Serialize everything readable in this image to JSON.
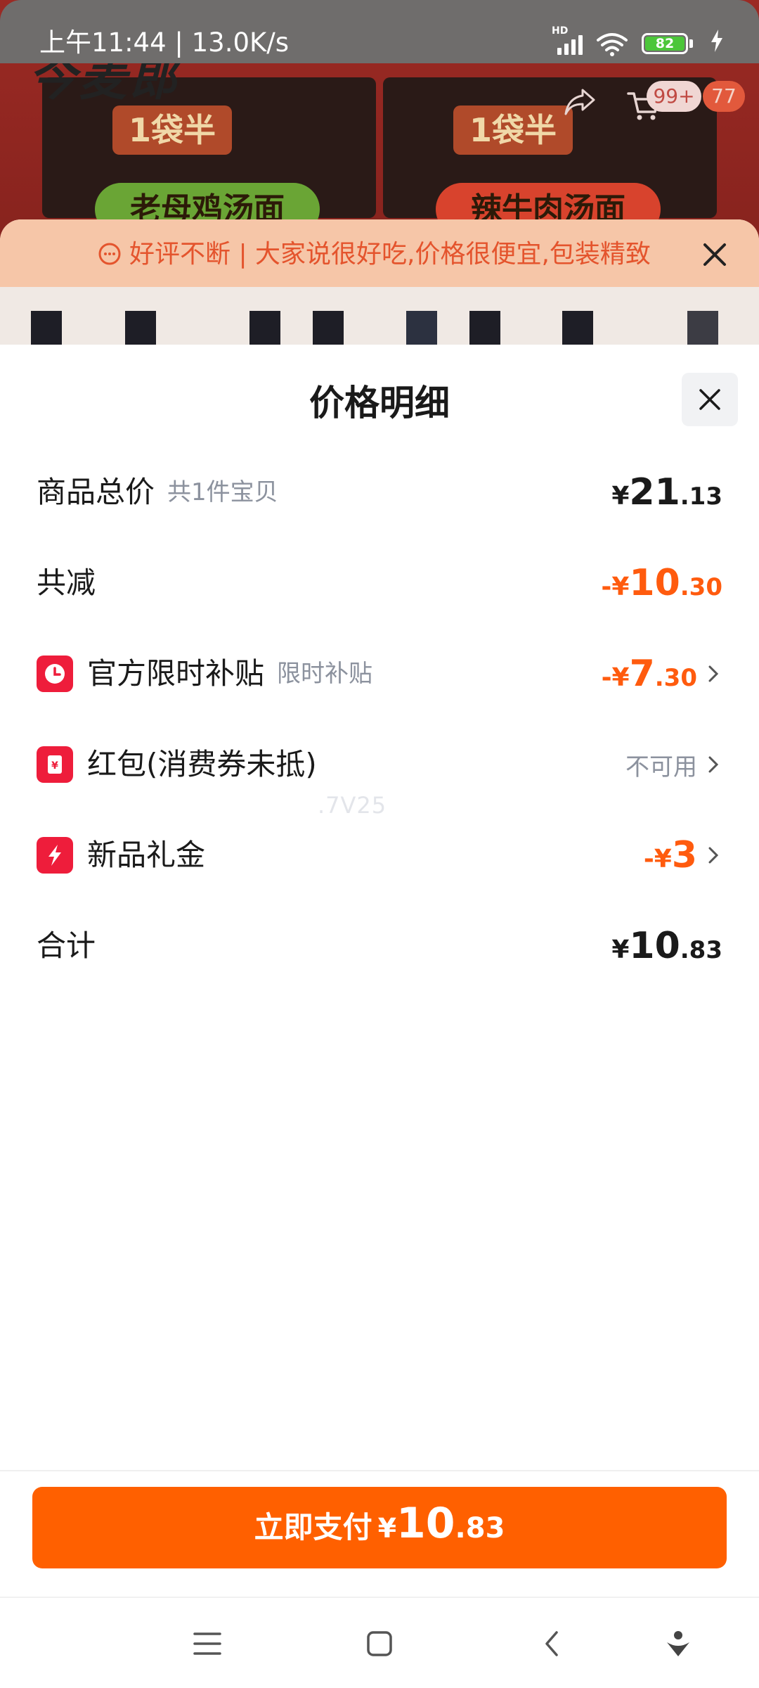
{
  "status_bar": {
    "time": "上午11:44 | 13.0K/s",
    "network_label": "HD",
    "battery_level": "82"
  },
  "background": {
    "brand": "今麦郎",
    "packs": [
      {
        "tag": "1袋半",
        "name": "老母鸡汤面"
      },
      {
        "tag": "1袋半",
        "name": "辣牛肉汤面"
      }
    ],
    "cart_badge": "99+",
    "message_badge": "77"
  },
  "review_strip": {
    "text": "好评不断 | 大家说很好吃,价格很便宜,包装精致"
  },
  "price_sheet": {
    "title": "价格明细",
    "rows": [
      {
        "label": "商品总价",
        "sub": "共1件宝贝",
        "price": {
          "sym": "¥",
          "int": "21",
          "dec": ".13"
        }
      },
      {
        "label": "共减",
        "price": {
          "sym": "-¥",
          "int": "10",
          "dec": ".30"
        }
      },
      {
        "label": "官方限时补贴",
        "sub": "限时补贴",
        "price": {
          "sym": "-¥",
          "int": "7",
          "dec": ".30"
        }
      },
      {
        "label": "红包(消费券未抵)",
        "status": "不可用"
      },
      {
        "label": "新品礼金",
        "price": {
          "sym": "-¥",
          "int": "3",
          "dec": ""
        }
      },
      {
        "label": "合计",
        "price": {
          "sym": "¥",
          "int": "10",
          "dec": ".83"
        }
      }
    ],
    "watermark": ".7V25"
  },
  "pay_button": {
    "label": "立即支付",
    "sym": "¥",
    "int": "10",
    "dec": ".83"
  },
  "icons": {
    "close": "close-icon",
    "clock": "clock-icon",
    "red_packet": "red-packet-icon",
    "lightning": "lightning-icon",
    "chevron": "chevron-right-icon"
  },
  "colors": {
    "accent_orange": "#ff6000",
    "discount_orange": "#ff5b0e",
    "icon_red": "#ee1d3b",
    "muted_text": "#8c929e"
  }
}
